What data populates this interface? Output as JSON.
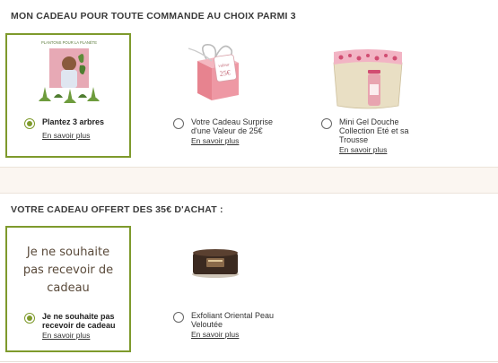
{
  "section1": {
    "title": "MON CADEAU POUR TOUTE COMMANDE AU CHOIX PARMI 3",
    "options": [
      {
        "label": "Plantez 3 arbres",
        "link": "En savoir plus",
        "selected": true,
        "image_caption": "PLANTONS POUR LA PLANÈTE"
      },
      {
        "label": "Votre Cadeau Surprise d'une Valeur de 25€",
        "link": "En savoir plus",
        "selected": false,
        "tag_line1": "valeur",
        "tag_line2": "25€"
      },
      {
        "label": "Mini Gel Douche Collection Eté et sa Trousse",
        "link": "En savoir plus",
        "selected": false
      }
    ]
  },
  "section2": {
    "title": "VOTRE CADEAU OFFERT DES 35€ D'ACHAT :",
    "options": [
      {
        "label": "Je ne souhaite pas recevoir de cadeau",
        "link": "En savoir plus",
        "selected": true,
        "big_text": "Je ne souhaite pas recevoir de cadeau"
      },
      {
        "label": "Exfoliant Oriental Peau Veloutée",
        "link": "En savoir plus",
        "selected": false
      }
    ]
  },
  "colors": {
    "accent": "#7e9a2c",
    "gift_pink": "#e88c9a",
    "band": "#fbf6f1"
  }
}
